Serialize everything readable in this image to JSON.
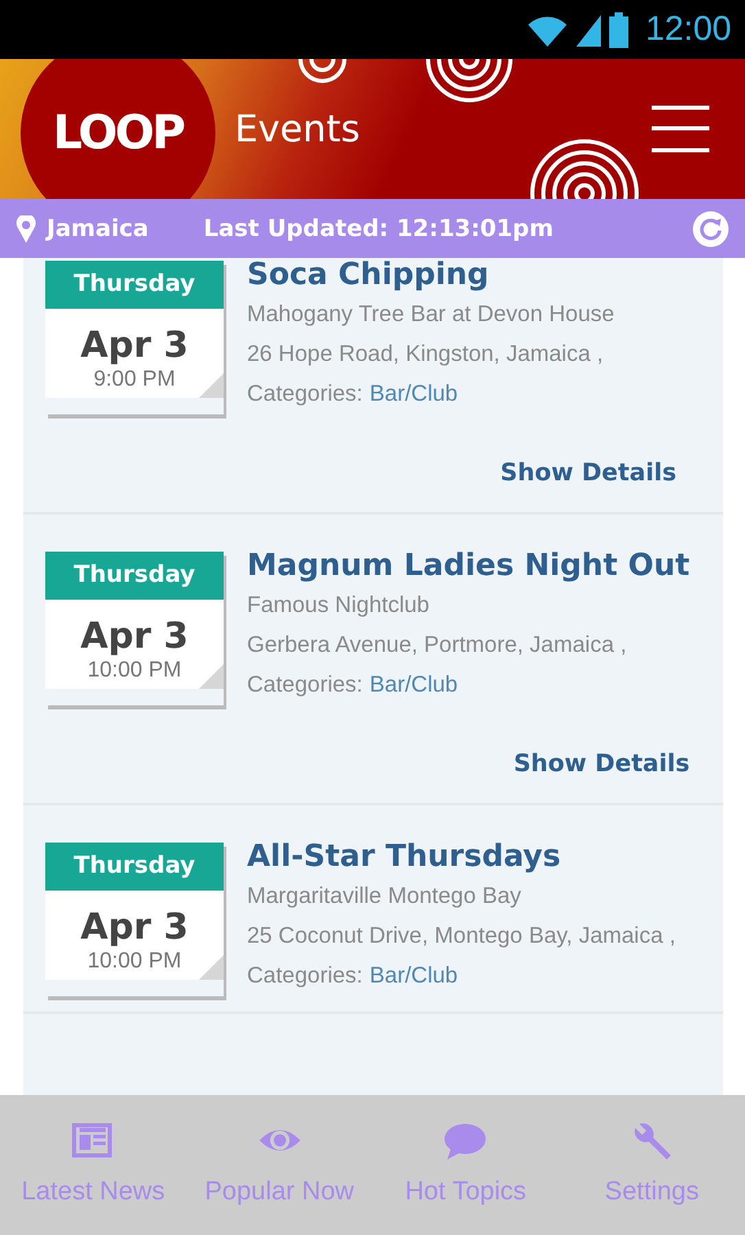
{
  "status_bar": {
    "time": "12:00"
  },
  "header": {
    "logo": "LOOP",
    "title": "Events"
  },
  "location_bar": {
    "location": "Jamaica",
    "updated": "Last Updated: 12:13:01pm"
  },
  "events": [
    {
      "day": "Thursday",
      "date": "Apr 3",
      "time": "9:00 PM",
      "title": "Soca Chipping",
      "venue": "Mahogany Tree Bar at Devon House",
      "address": "26 Hope Road, Kingston, Jamaica ,",
      "category_label": "Categories:",
      "category": "Bar/Club",
      "action": "Show Details"
    },
    {
      "day": "Thursday",
      "date": "Apr 3",
      "time": "10:00 PM",
      "title": "Magnum Ladies Night Out",
      "venue": "Famous Nightclub",
      "address": "Gerbera Avenue, Portmore, Jamaica ,",
      "category_label": "Categories:",
      "category": "Bar/Club",
      "action": "Show Details"
    },
    {
      "day": "Thursday",
      "date": "Apr 3",
      "time": "10:00 PM",
      "title": "All-Star Thursdays",
      "venue": "Margaritaville Montego Bay",
      "address": "25 Coconut Drive, Montego Bay, Jamaica ,",
      "category_label": "Categories:",
      "category": "Bar/Club"
    }
  ],
  "bottom_nav": [
    {
      "kind": "news",
      "label": "Latest News"
    },
    {
      "kind": "eye",
      "label": "Popular Now"
    },
    {
      "kind": "chat",
      "label": "Hot Topics"
    },
    {
      "kind": "wrench",
      "label": "Settings"
    }
  ]
}
